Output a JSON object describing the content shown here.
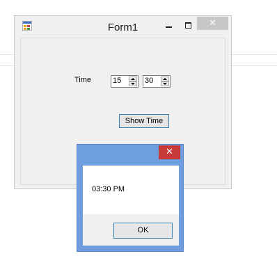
{
  "form": {
    "title": "Form1",
    "minimize_glyph": "",
    "close_glyph": "✕",
    "time_label": "Time",
    "hour_value": "15",
    "minute_value": "30",
    "show_time_button": "Show Time"
  },
  "message_box": {
    "close_glyph": "✕",
    "message": "03:30 PM",
    "ok_button": "OK"
  },
  "icons": {
    "app": "app-icon",
    "minimize": "minimize-icon",
    "maximize": "maximize-icon",
    "close": "close-icon",
    "spin_up": "arrow-up-icon",
    "spin_down": "arrow-down-icon"
  }
}
